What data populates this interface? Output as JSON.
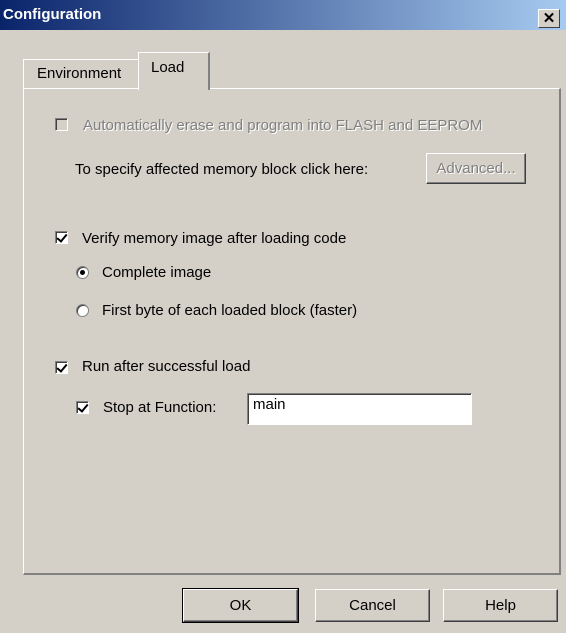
{
  "window": {
    "title": "Configuration",
    "close_glyph": "✕"
  },
  "tabs": [
    {
      "label": "Environment",
      "active": false
    },
    {
      "label": "Load",
      "active": true
    }
  ],
  "load": {
    "auto_erase": {
      "label": "Automatically erase and program into FLASH and EEPROM",
      "checked": false,
      "enabled": false
    },
    "advanced": {
      "hint": "To specify affected memory block click here:",
      "button_label": "Advanced..."
    },
    "verify": {
      "label": "Verify memory image after loading code",
      "checked": true
    },
    "verify_options": [
      {
        "label": "Complete image",
        "selected": true
      },
      {
        "label": "First byte of each loaded block (faster)",
        "selected": false
      }
    ],
    "run_after": {
      "label": "Run after successful load",
      "checked": true
    },
    "stop_at": {
      "label": "Stop at Function:",
      "checked": true,
      "value": "main"
    }
  },
  "buttons": {
    "ok": "OK",
    "cancel": "Cancel",
    "help": "Help"
  }
}
